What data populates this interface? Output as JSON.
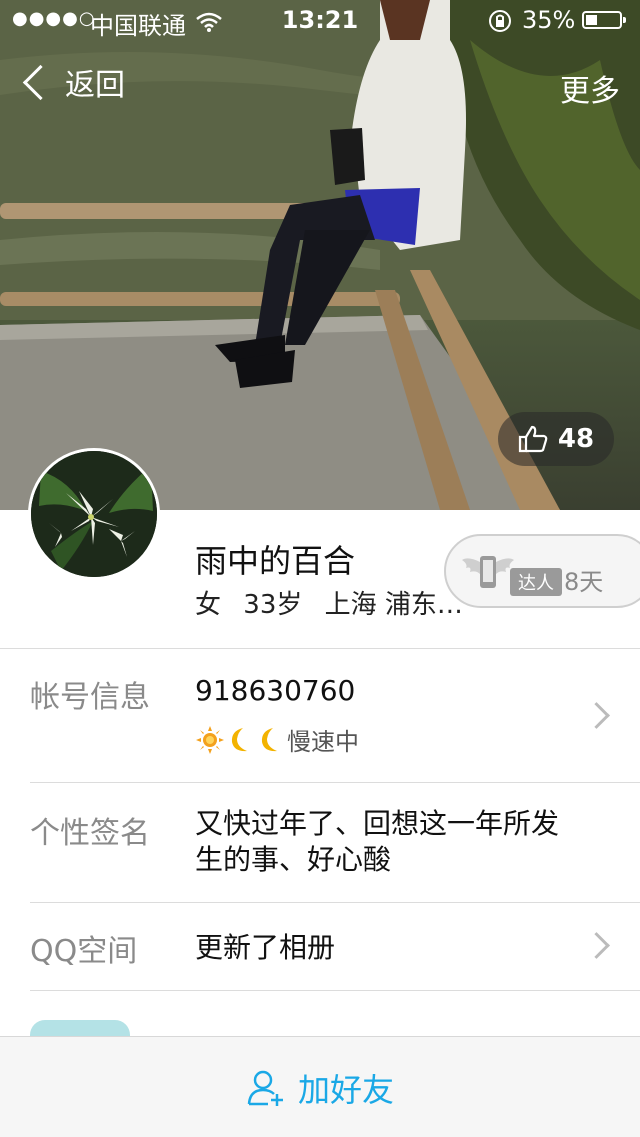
{
  "status_bar": {
    "signal": "●●●●○",
    "carrier": "中国联通",
    "time": "13:21",
    "battery": "35%",
    "battery_level": 0.35
  },
  "nav": {
    "back_label": "返回",
    "more_label": "更多"
  },
  "likes": "48",
  "profile": {
    "nickname": "雨中的百合",
    "gender": "女",
    "age": "33岁",
    "location": "上海 浦东…",
    "expert_badge": "达人",
    "expert_days": "8天"
  },
  "rows": {
    "account": {
      "label": "帐号信息",
      "value": "918630760",
      "level_status": "慢速中"
    },
    "signature": {
      "label": "个性签名",
      "value": "又快过年了、回想这一年所发生的事、好心酸"
    },
    "qzone": {
      "label": "QQ空间",
      "value": "更新了相册"
    }
  },
  "bottom": {
    "add_friend_label": "加好友"
  },
  "colors": {
    "accent": "#1aa8e6",
    "label_gray": "#8a8a8a",
    "level_sun": "#f3a11c",
    "level_moon": "#f3b300"
  }
}
